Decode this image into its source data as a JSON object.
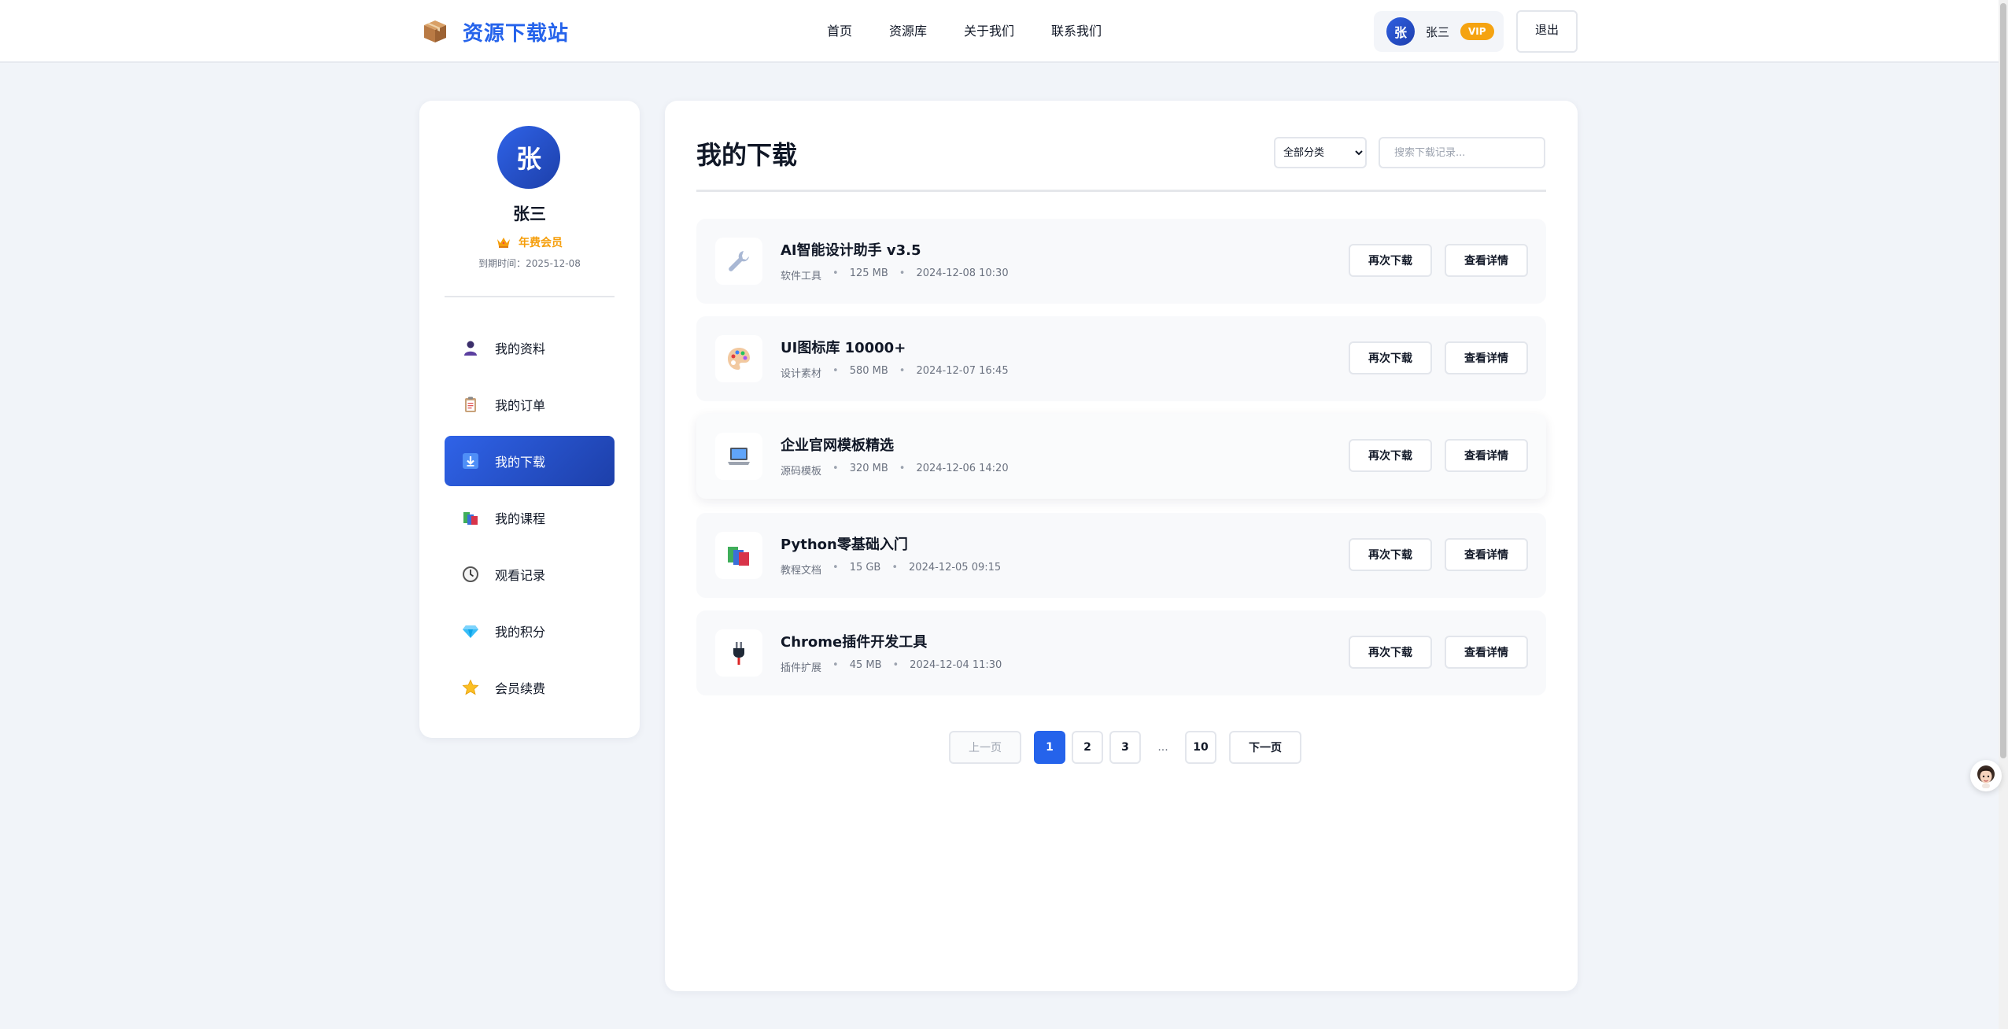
{
  "header": {
    "logo_text": "资源下载站",
    "logo_icon": "package-box-icon",
    "nav": [
      {
        "label": "首页"
      },
      {
        "label": "资源库"
      },
      {
        "label": "关于我们"
      },
      {
        "label": "联系我们"
      }
    ],
    "user": {
      "avatar_initial": "张",
      "name": "张三",
      "badge": "VIP"
    },
    "logout_label": "退出"
  },
  "sidebar": {
    "avatar_initial": "张",
    "name": "张三",
    "membership": "年费会员",
    "membership_icon": "crown-icon",
    "expiry": "到期时间：2025-12-08",
    "menu": [
      {
        "label": "我的资料",
        "icon": "user-silhouette-icon",
        "active": false
      },
      {
        "label": "我的订单",
        "icon": "clipboard-icon",
        "active": false
      },
      {
        "label": "我的下载",
        "icon": "download-arrow-icon",
        "active": true
      },
      {
        "label": "我的课程",
        "icon": "books-icon",
        "active": false
      },
      {
        "label": "观看记录",
        "icon": "clock-icon",
        "active": false
      },
      {
        "label": "我的积分",
        "icon": "diamond-icon",
        "active": false
      },
      {
        "label": "会员续费",
        "icon": "star-icon",
        "active": false
      }
    ]
  },
  "main": {
    "title": "我的下载",
    "category_select": {
      "selected": "全部分类"
    },
    "search": {
      "placeholder": "搜索下载记录...",
      "value": ""
    },
    "items": [
      {
        "title": "AI智能设计助手 v3.5",
        "category": "软件工具",
        "size": "125 MB",
        "date": "2024-12-08 10:30",
        "icon": "wrench-icon"
      },
      {
        "title": "UI图标库 10000+",
        "category": "设计素材",
        "size": "580 MB",
        "date": "2024-12-07 16:45",
        "icon": "palette-icon"
      },
      {
        "title": "企业官网模板精选",
        "category": "源码模板",
        "size": "320 MB",
        "date": "2024-12-06 14:20",
        "icon": "laptop-icon"
      },
      {
        "title": "Python零基础入门",
        "category": "教程文档",
        "size": "15 GB",
        "date": "2024-12-05 09:15",
        "icon": "books-icon"
      },
      {
        "title": "Chrome插件开发工具",
        "category": "插件扩展",
        "size": "45 MB",
        "date": "2024-12-04 11:30",
        "icon": "plug-icon"
      }
    ],
    "redownload_label": "再次下载",
    "detail_label": "查看详情",
    "pagination": {
      "prev": "上一页",
      "pages": [
        "1",
        "2",
        "3"
      ],
      "ellipsis": "...",
      "last": "10",
      "next": "下一页",
      "current": "1"
    }
  },
  "floating_helper": {
    "icon": "assistant-avatar-icon"
  },
  "colors": {
    "accent": "#2563eb",
    "accent_dark": "#1d3fa9",
    "vip": "#f5a311",
    "page_bg": "#f1f4f9"
  }
}
